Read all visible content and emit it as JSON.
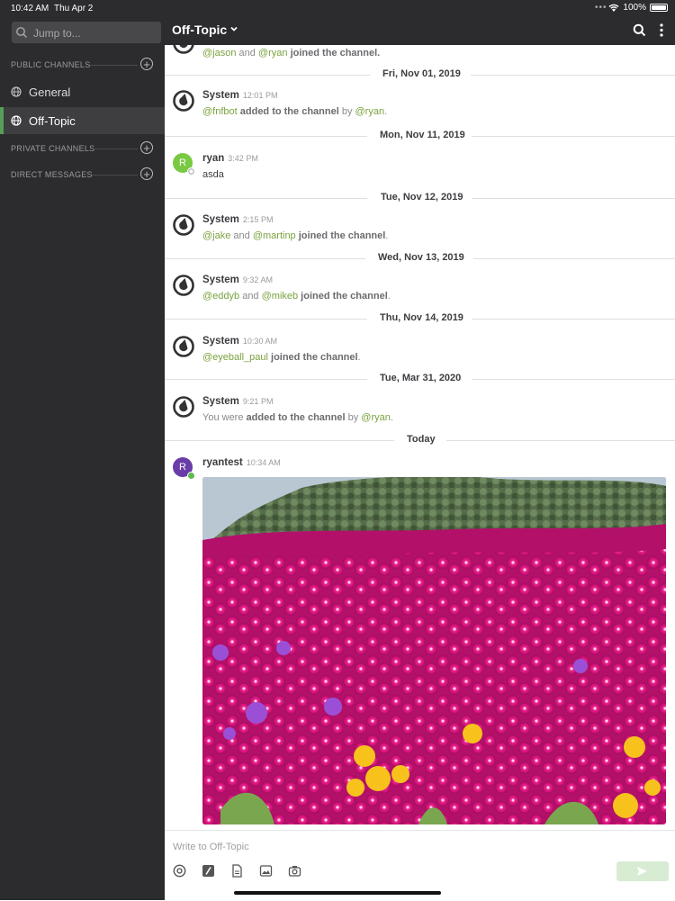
{
  "status_bar": {
    "time": "10:42 AM",
    "date": "Thu Apr 2",
    "battery": "100%"
  },
  "sidebar": {
    "jump_placeholder": "Jump to...",
    "sections": {
      "public": "PUBLIC CHANNELS",
      "private": "PRIVATE CHANNELS",
      "direct": "DIRECT MESSAGES"
    },
    "channels": [
      {
        "label": "General"
      },
      {
        "label": "Off-Topic",
        "active": true
      }
    ]
  },
  "header": {
    "title": "Off-Topic"
  },
  "feed": {
    "first_line": {
      "user1": "@jason",
      "and": "and",
      "user2": "@ryan",
      "action": "joined the channel."
    },
    "dates": [
      "Fri, Nov 01, 2019",
      "Mon, Nov 11, 2019",
      "Tue, Nov 12, 2019",
      "Wed, Nov 13, 2019",
      "Thu, Nov 14, 2019",
      "Tue, Mar 31, 2020",
      "Today"
    ],
    "messages": [
      {
        "user": "System",
        "time": "12:01 PM",
        "parts": [
          "@fnfbot",
          " added to the channel",
          " by ",
          "@ryan",
          "."
        ]
      },
      {
        "user": "ryan",
        "time": "3:42 PM",
        "text": "asda"
      },
      {
        "user": "System",
        "time": "2:15 PM",
        "parts": [
          "@jake",
          " and ",
          "@martinp",
          " joined the channel",
          "."
        ]
      },
      {
        "user": "System",
        "time": "9:32 AM",
        "parts": [
          "@eddyb",
          " and ",
          "@mikeb",
          " joined the channel",
          "."
        ]
      },
      {
        "user": "System",
        "time": "10:30 AM",
        "parts": [
          "@eyeball_paul",
          " joined the channel",
          "."
        ]
      },
      {
        "user": "System",
        "time": "9:21 PM",
        "parts": [
          "You were ",
          "added to the channel",
          " by ",
          "@ryan",
          "."
        ]
      },
      {
        "user": "ryantest",
        "time": "10:34 AM"
      }
    ],
    "avatar_letter": "R"
  },
  "composer": {
    "placeholder": "Write to Off-Topic"
  },
  "colors": {
    "sidebar_bg": "#2c2c2f",
    "accent": "#589d59",
    "mention": "#7aa23f",
    "ryan_avatar": "#7ac943",
    "ryantest_avatar": "#6a3ca8"
  }
}
